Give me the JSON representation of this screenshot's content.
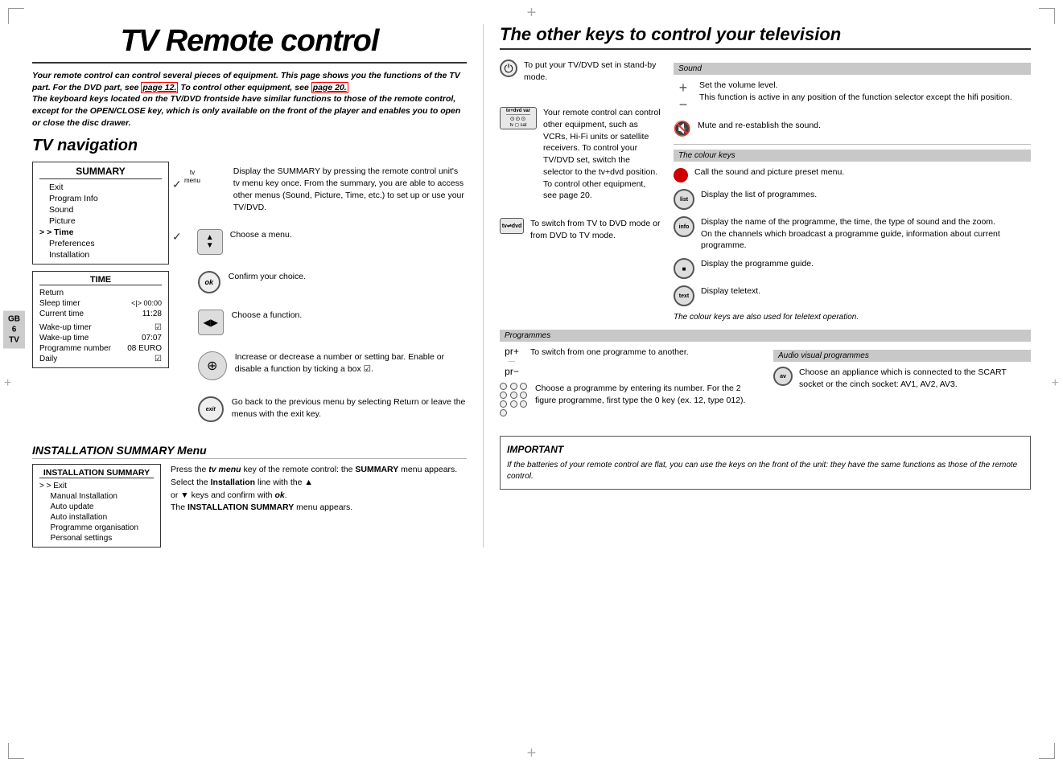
{
  "page": {
    "title": "TV Remote control",
    "corner_marks": [
      "tl",
      "tr",
      "bl",
      "br"
    ]
  },
  "intro": {
    "text1": "Your remote control can control several pieces of equipment. This page shows you the functions of the TV part. For the DVD part, see ",
    "link": "page 12.",
    "text2": " To control other equipment, see ",
    "link2": "page 20.",
    "text3": "The keyboard keys located on the TV/DVD frontside have similar functions to those of the remote control, except for the OPEN/CLOSE key, which is only available on the front of the player and enables you to open or close the disc drawer."
  },
  "tv_navigation": {
    "title": "TV navigation",
    "summary_menu": {
      "title": "SUMMARY",
      "items": [
        "Exit",
        "Program Info",
        "Sound",
        "Picture",
        "> Time",
        "Preferences",
        "Installation"
      ]
    },
    "tv_menu_label": "tv\nmenu",
    "time_menu": {
      "title": "TIME",
      "rows": [
        {
          "label": "Return",
          "value": ""
        },
        {
          "label": "Sleep timer",
          "value": "<|>  00:00"
        },
        {
          "label": "Current time",
          "value": "11:28"
        },
        {
          "label": "",
          "value": ""
        },
        {
          "label": "Wake-up timer",
          "value": "☑"
        },
        {
          "label": "Wake-up time",
          "value": "07:07"
        },
        {
          "label": "Programme number",
          "value": "08 EURO"
        },
        {
          "label": "Daily",
          "value": "☑"
        }
      ]
    },
    "key_descriptions": {
      "display_summary": "Display the SUMMARY by pressing the remote control unit's tv menu key once. From the summary, you are able to access other menus (Sound, Picture, Time, etc.) to set up or use your TV/DVD.",
      "choose_menu": "Choose a menu.",
      "confirm_choice": "Confirm your choice.",
      "choose_function": "Choose a function.",
      "increase_decrease": "Increase or decrease a number or setting bar. Enable or disable a function by ticking a box ☑.",
      "go_back": "Go back to the previous menu by selecting Return or leave the menus with the exit key."
    }
  },
  "installation_summary": {
    "title": "INSTALLATION SUMMARY Menu",
    "menu": {
      "title": "INSTALLATION SUMMARY",
      "items": [
        "> Exit",
        "Manual Installation",
        "Auto update",
        "Auto installation",
        "Programme organisation",
        "Personal settings"
      ]
    },
    "description": {
      "line1": "Press the tv menu key of the remote control: the SUMMARY menu appears.",
      "line2": "Select the Installation line with the",
      "line3": "or    keys and confirm with ok.",
      "line4": "The INSTALLATION SUMMARY menu appears."
    }
  },
  "gb_badge": {
    "line1": "GB",
    "line2": "6",
    "line3": "TV"
  },
  "other_keys": {
    "title": "The other keys to control your television",
    "sound_section": {
      "label": "Sound",
      "items": [
        {
          "icon": "vol",
          "text": "Set the volume level.\nThis function is active in any position of the function selector except the hifi position."
        },
        {
          "icon": "mute",
          "text": "Mute and re-establish the sound."
        }
      ]
    },
    "colour_keys_section": {
      "label": "The colour keys",
      "items": [
        {
          "color": "#c00",
          "text": "Call the sound and picture preset menu."
        },
        {
          "icon": "list",
          "label": "list",
          "text": "Display the list of programmes."
        },
        {
          "icon": "info",
          "label": "info",
          "text": "Display the name of the programme, the time, the type of sound and the zoom.\nOn the channels which broadcast a programme guide, information about current programme."
        },
        {
          "icon": "guide",
          "label": "■",
          "text": "Display the programme guide."
        },
        {
          "icon": "text",
          "label": "text",
          "text": "Display teletext."
        }
      ],
      "note": "The colour keys are also used for teletext operation."
    },
    "programmes_section": {
      "label": "Programmes",
      "items": [
        {
          "icon": "pr_arrows",
          "text": "To switch from one programme to another."
        },
        {
          "icon": "numpad",
          "text": "Choose a programme by entering its number. For the 2 figure programme, first type the 0 key (ex. 12, type 012)."
        }
      ]
    },
    "av_section": {
      "label": "Audio visual programmes",
      "items": [
        {
          "icon": "av",
          "text": "Choose an appliance which is connected to the SCART socket or the cinch socket: AV1, AV2, AV3."
        }
      ]
    },
    "standby": {
      "icon": "power",
      "text": "To put your TV/DVD set in stand-by mode."
    },
    "equipment_control": {
      "icon": "equip",
      "text": "Your remote control can control other equipment, such as VCRs, Hi-Fi units or satellite receivers.\nTo control your TV/DVD set, switch the selector to the tv+dvd position.\nTo control other equipment, see page 20."
    },
    "tv_dvd_switch": {
      "icon": "tv_dvd",
      "text": "To switch from TV to DVD mode or from DVD to TV mode."
    },
    "important": {
      "title": "IMPORTANT",
      "text": "If the batteries of your remote control are flat, you can use the keys on the front of the unit: they have the same functions as those of the remote control."
    }
  }
}
